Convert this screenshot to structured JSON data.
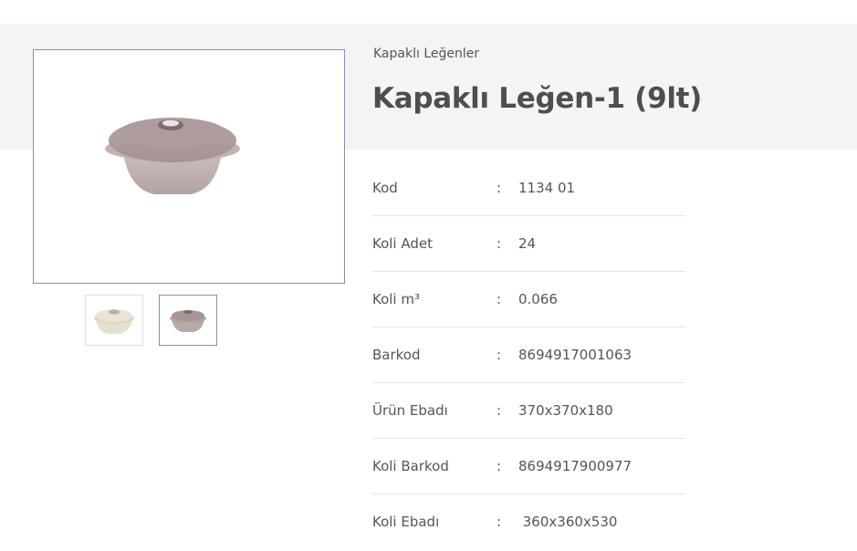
{
  "product": {
    "category": "Kapaklı Leğenler",
    "title": "Kapaklı Leğen-1 (9lt)"
  },
  "gallery": {
    "main_image": "lidded-bowl-taupe",
    "thumbnails": [
      "lidded-bowl-cream",
      "lidded-bowl-taupe"
    ]
  },
  "specs": [
    {
      "label": "Kod",
      "value": "1134 01"
    },
    {
      "label": "Koli Adet",
      "value": "24"
    },
    {
      "label": "Koli m³",
      "value": "0.066"
    },
    {
      "label": "Barkod",
      "value": "8694917001063"
    },
    {
      "label": "Ürün Ebadı",
      "value": "370x370x180"
    },
    {
      "label": "Koli Barkod",
      "value": "8694917900977"
    },
    {
      "label": "Koli Ebadı",
      "value": " 360x360x530"
    }
  ],
  "separator": ":",
  "colors": {
    "band": "#f4f4f4",
    "accent_border": "#8d8ab4",
    "taupe_bowl": "#c6b8b6",
    "cream_bowl": "#e6e0cf"
  }
}
